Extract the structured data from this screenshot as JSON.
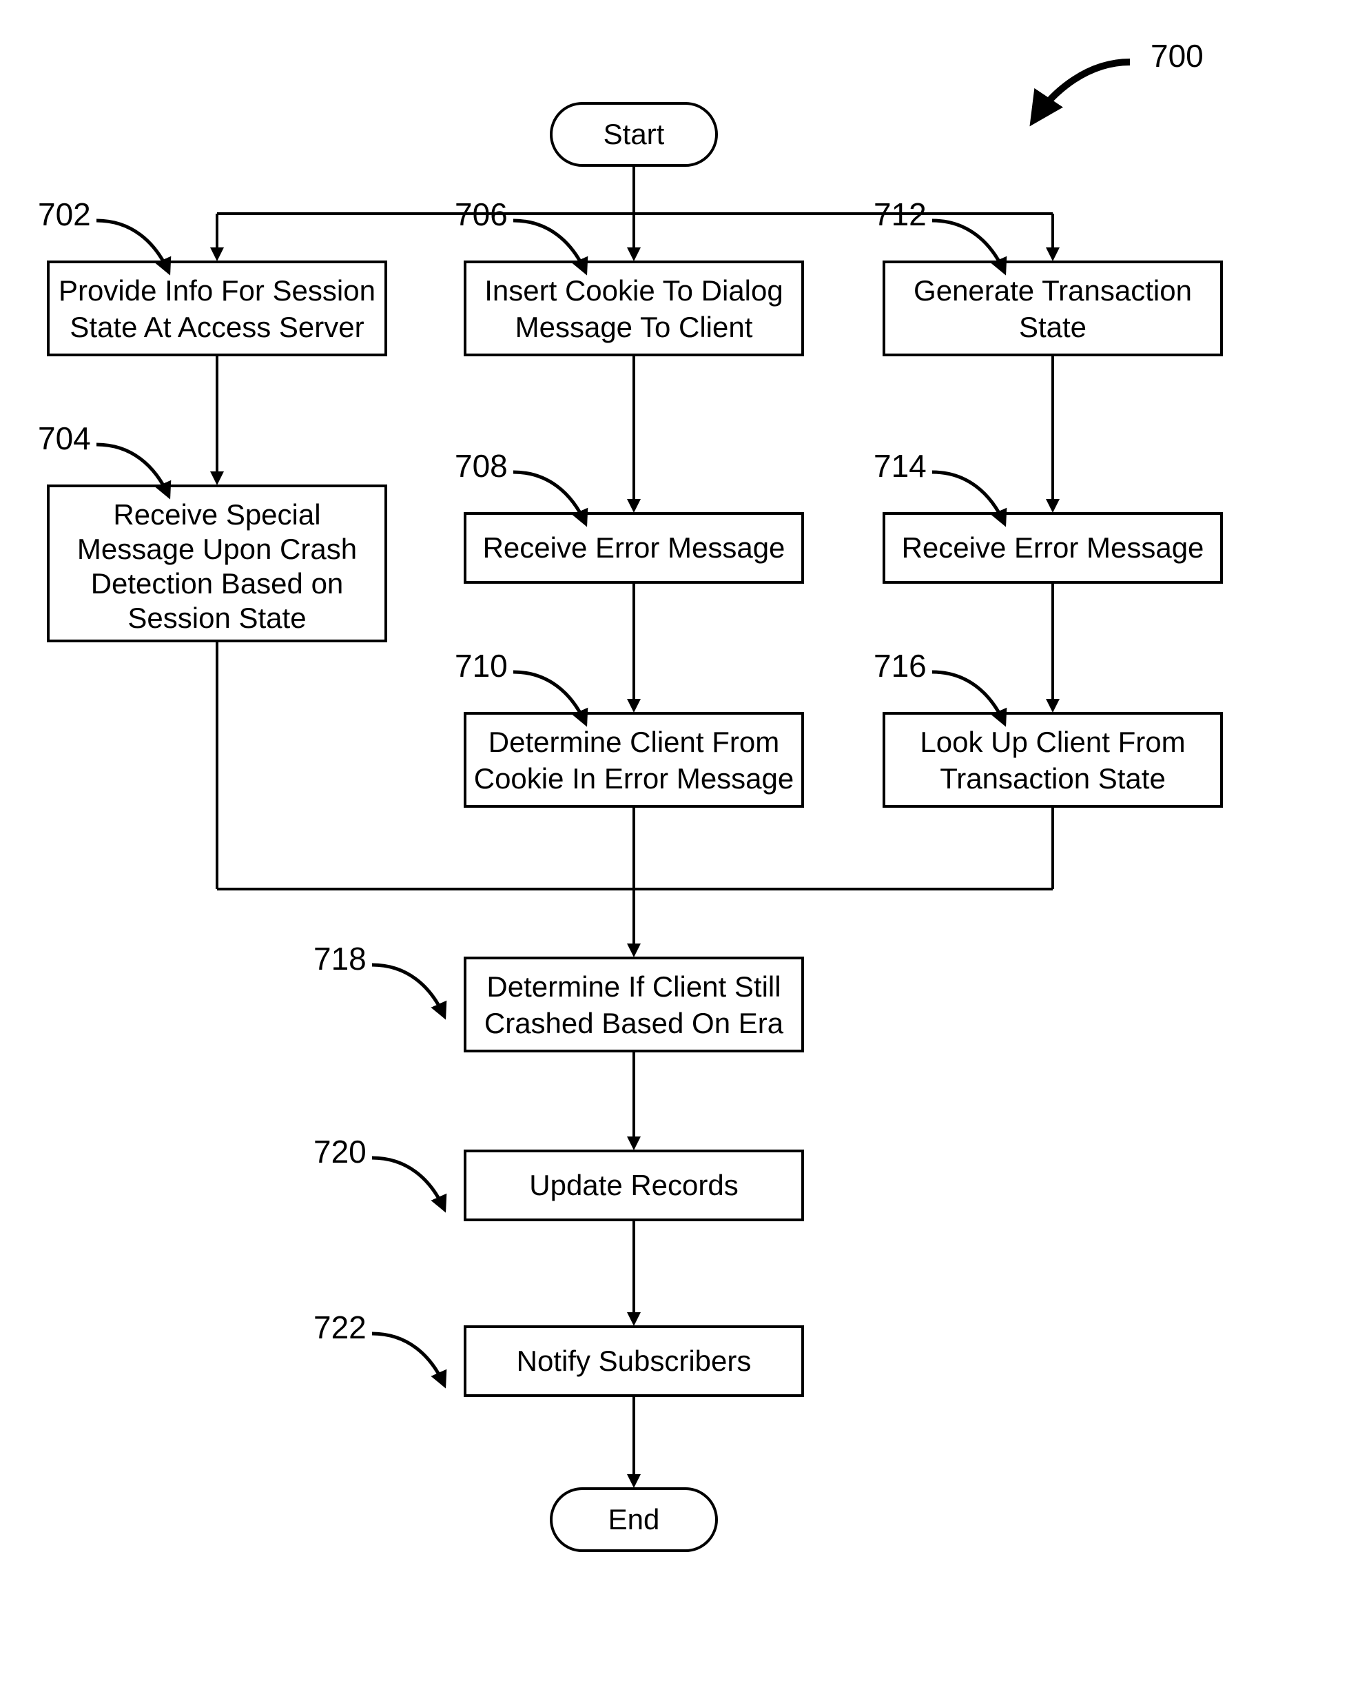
{
  "chart_data": {
    "type": "flowchart",
    "title_ref": "700",
    "nodes": [
      {
        "id": "start",
        "type": "terminator",
        "text": "Start"
      },
      {
        "id": "702",
        "ref": "702",
        "type": "process",
        "text": "Provide Info For Session State At Access Server"
      },
      {
        "id": "704",
        "ref": "704",
        "type": "process",
        "text": "Receive Special Message Upon Crash Detection Based on Session State"
      },
      {
        "id": "706",
        "ref": "706",
        "type": "process",
        "text": "Insert Cookie To Dialog Message To Client"
      },
      {
        "id": "708",
        "ref": "708",
        "type": "process",
        "text": "Receive Error Message"
      },
      {
        "id": "710",
        "ref": "710",
        "type": "process",
        "text": "Determine Client From Cookie In Error Message"
      },
      {
        "id": "712",
        "ref": "712",
        "type": "process",
        "text": "Generate Transaction State"
      },
      {
        "id": "714",
        "ref": "714",
        "type": "process",
        "text": "Receive Error Message"
      },
      {
        "id": "716",
        "ref": "716",
        "type": "process",
        "text": "Look Up Client From Transaction State"
      },
      {
        "id": "718",
        "ref": "718",
        "type": "process",
        "text": "Determine If Client Still Crashed Based On Era"
      },
      {
        "id": "720",
        "ref": "720",
        "type": "process",
        "text": "Update Records"
      },
      {
        "id": "722",
        "ref": "722",
        "type": "process",
        "text": "Notify Subscribers"
      },
      {
        "id": "end",
        "type": "terminator",
        "text": "End"
      }
    ],
    "edges": [
      {
        "from": "start",
        "to": "702"
      },
      {
        "from": "start",
        "to": "706"
      },
      {
        "from": "start",
        "to": "712"
      },
      {
        "from": "702",
        "to": "704"
      },
      {
        "from": "706",
        "to": "708"
      },
      {
        "from": "708",
        "to": "710"
      },
      {
        "from": "712",
        "to": "714"
      },
      {
        "from": "714",
        "to": "716"
      },
      {
        "from": "704",
        "to": "718"
      },
      {
        "from": "710",
        "to": "718"
      },
      {
        "from": "716",
        "to": "718"
      },
      {
        "from": "718",
        "to": "720"
      },
      {
        "from": "720",
        "to": "722"
      },
      {
        "from": "722",
        "to": "end"
      }
    ]
  },
  "labels": {
    "figure_ref": "700",
    "start": "Start",
    "end": "End",
    "n702_ref": "702",
    "n702_l1": "Provide Info For Session",
    "n702_l2": "State At Access Server",
    "n704_ref": "704",
    "n704_l1": "Receive Special",
    "n704_l2": "Message Upon Crash",
    "n704_l3": "Detection Based on",
    "n704_l4": "Session State",
    "n706_ref": "706",
    "n706_l1": "Insert Cookie To Dialog",
    "n706_l2": "Message To Client",
    "n708_ref": "708",
    "n708_l1": "Receive Error Message",
    "n710_ref": "710",
    "n710_l1": "Determine Client From",
    "n710_l2": "Cookie In Error Message",
    "n712_ref": "712",
    "n712_l1": "Generate Transaction",
    "n712_l2": "State",
    "n714_ref": "714",
    "n714_l1": "Receive Error Message",
    "n716_ref": "716",
    "n716_l1": "Look Up Client From",
    "n716_l2": "Transaction State",
    "n718_ref": "718",
    "n718_l1": "Determine If Client Still",
    "n718_l2": "Crashed Based On Era",
    "n720_ref": "720",
    "n720_l1": "Update Records",
    "n722_ref": "722",
    "n722_l1": "Notify Subscribers"
  }
}
